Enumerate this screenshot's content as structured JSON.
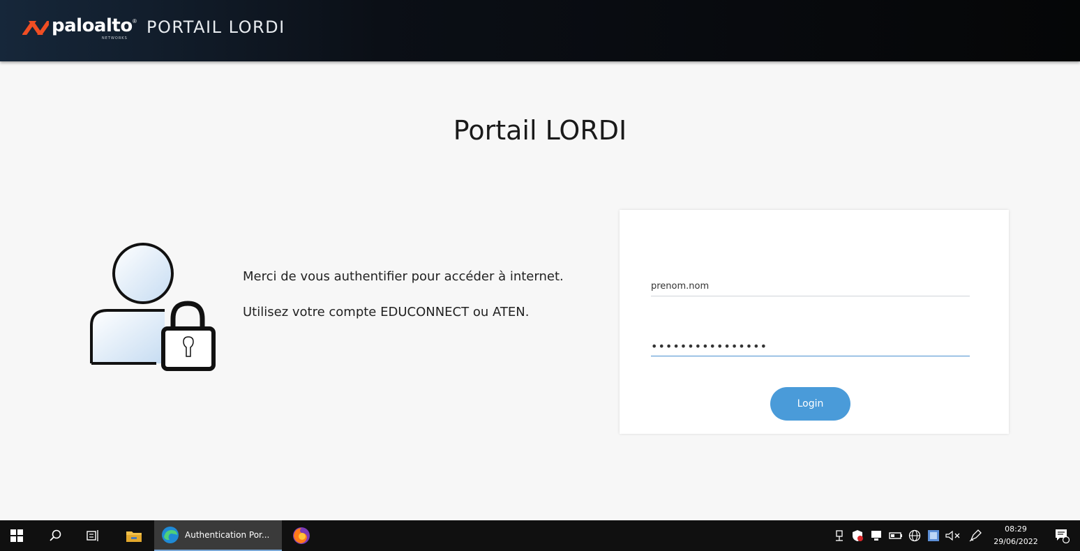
{
  "header": {
    "logo_text": "paloalto",
    "logo_subtext": "NETWORKS",
    "logo_reg": "®",
    "title": "PORTAIL LORDI"
  },
  "main": {
    "page_title": "Portail LORDI",
    "message_line1": "Merci de vous authentifier pour accéder à internet.",
    "message_line2": "Utilisez votre compte EDUCONNECT ou ATEN."
  },
  "login": {
    "username_value": "prenom.nom",
    "password_value": "••••••••••••••••",
    "button_label": "Login"
  },
  "taskbar": {
    "active_task_label": "Authentication Por...",
    "clock_time": "08:29",
    "clock_date": "29/06/2022"
  },
  "colors": {
    "accent": "#4a9bd9",
    "header_bg": "#0b0f16",
    "brand_orange": "#f04e23"
  }
}
